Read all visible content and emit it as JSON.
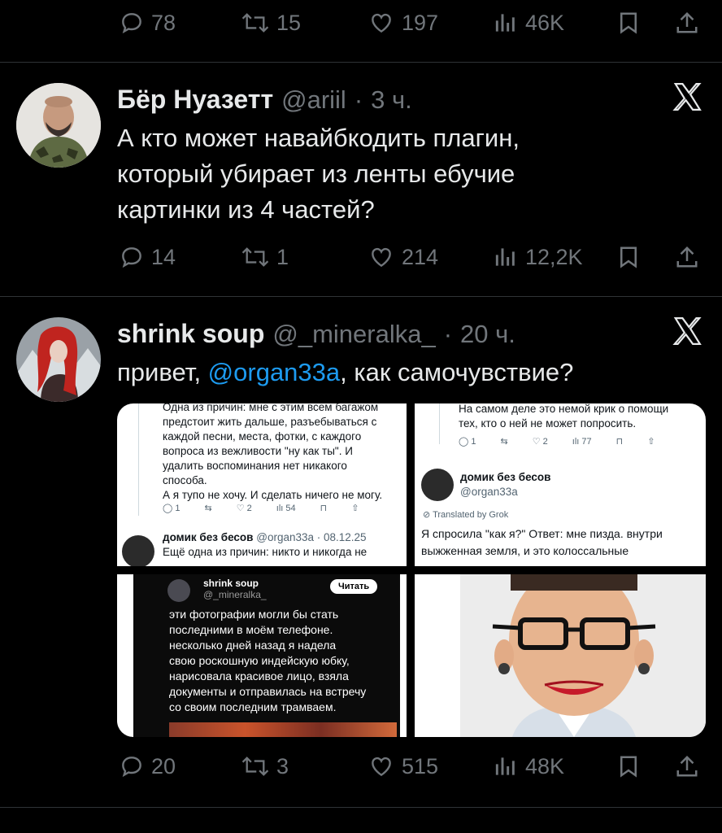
{
  "prev_actions": {
    "reply": "78",
    "retweet": "15",
    "like": "197",
    "views": "46K"
  },
  "tweet1": {
    "name": "Бёр Нуазетт",
    "handle": "@ariil",
    "dot": "·",
    "time": "3 ч.",
    "text_lines": [
      "А кто может навайбкодить плагин,",
      "который убирает из ленты ебучие",
      "картинки из 4 частей?"
    ],
    "actions": {
      "reply": "14",
      "retweet": "1",
      "like": "214",
      "views": "12,2K"
    }
  },
  "tweet2": {
    "name": "shrink soup",
    "handle": "@_mineralka_",
    "dot": "·",
    "time": "20 ч.",
    "text_prefix": "привет, ",
    "mention": "@organ33a",
    "text_suffix": ", как самочувствие?",
    "actions": {
      "reply": "20",
      "retweet": "3",
      "like": "515",
      "views": "48K"
    },
    "media": {
      "img1": {
        "top_lines": [
          "Одна из причин: мне с этим всем багажом",
          "предстоит жить дальше, разъебываться с",
          "каждой песни, места, фотки, с каждого",
          "вопроса из вежливости \"ну как ты\". И",
          "удалить воспоминания нет никакого",
          "способа.",
          "А я тупо не хочу. И сделать ничего не могу."
        ],
        "acts": {
          "reply": "1",
          "like": "2",
          "views": "54"
        },
        "name2": "домик без бесов",
        "handle2": "@organ33a · 08.12.25",
        "line2": "Ещё одна из причин: никто и никогда не"
      },
      "img2": {
        "top_lines": [
          "На самом деле это немой крик о помощи",
          "тех, кто о ней не может попросить."
        ],
        "acts": {
          "reply": "1",
          "like": "2",
          "views": "77"
        },
        "name": "домик без бесов",
        "handle": "@organ33a",
        "translated": "Translated by Grok",
        "lines": [
          "Я спросила \"как я?\" Ответ: мне пизда. внутри",
          "выжженная земля, и это колоссальные"
        ]
      },
      "img3": {
        "name": "shrink soup",
        "handle": "@_mineralka_",
        "button": "Читать",
        "lines": [
          "эти фотографии могли бы стать",
          "последними в моём телефоне.",
          "несколько дней назад я надела",
          "свою роскошную индейскую юбку,",
          "нарисовала красивое лицо, взяла",
          "документы и отправилась на встречу",
          "со своим последним трамваем."
        ]
      },
      "img4": {
        "desc": "portrait-photo"
      }
    }
  },
  "colors": {
    "bg": "#000000",
    "text": "#e7e9ea",
    "muted": "#71767b",
    "accent": "#1d9bf0",
    "divider": "#2f3336"
  }
}
